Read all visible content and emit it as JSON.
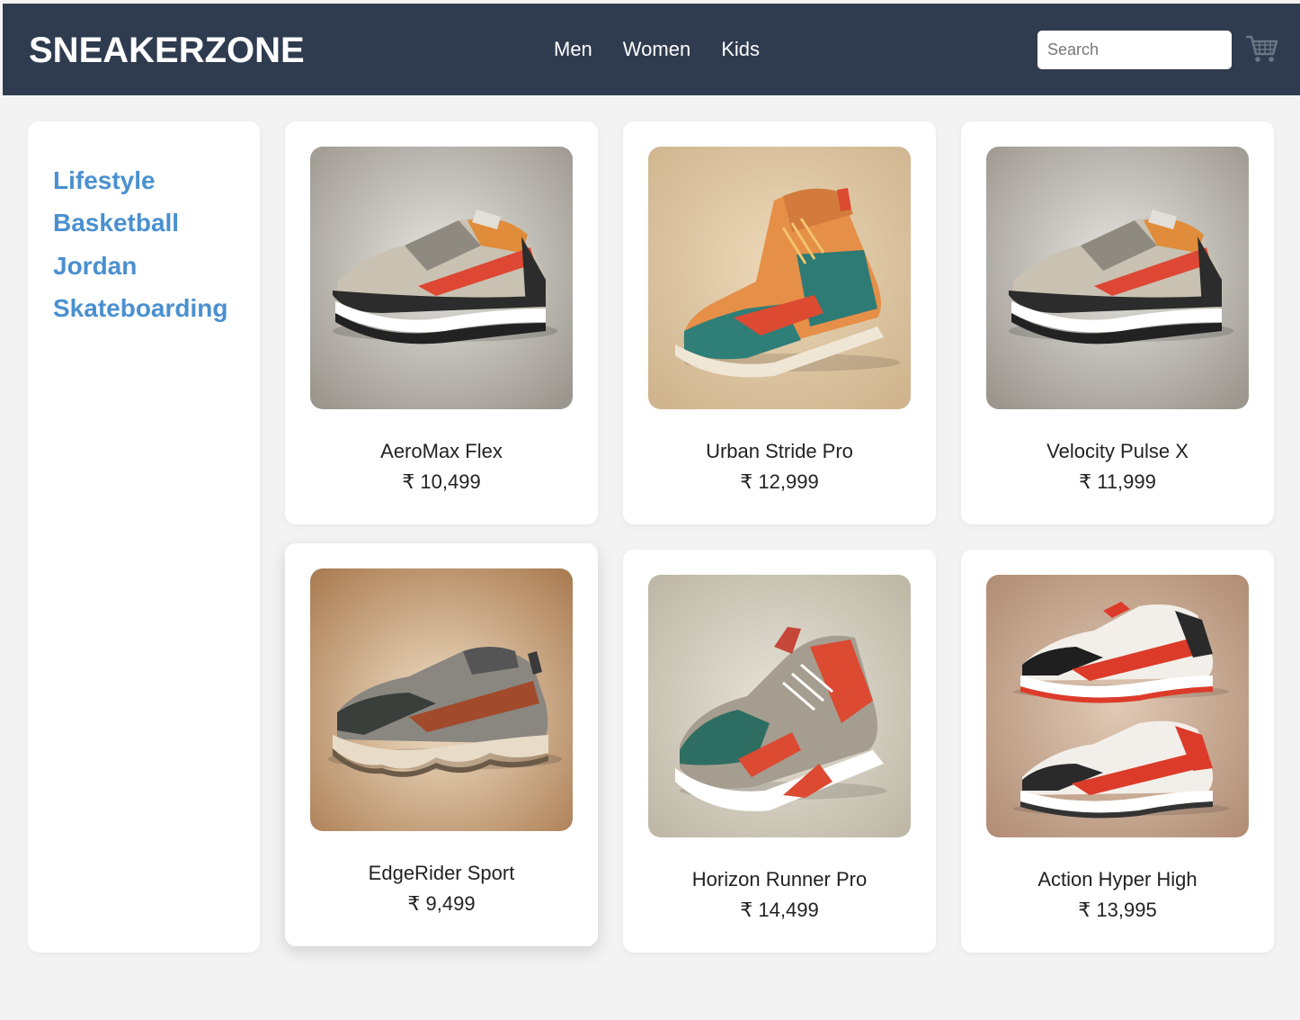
{
  "header": {
    "logo": "SNEAKERZONE",
    "nav": [
      "Men",
      "Women",
      "Kids"
    ],
    "search_placeholder": "Search",
    "cart_icon": "shopping-cart-icon",
    "bg_color": "#2f3c4f"
  },
  "sidebar": {
    "categories": [
      "Lifestyle",
      "Basketball",
      "Jordan",
      "Skateboarding"
    ],
    "link_color": "#4a90d0"
  },
  "products": [
    {
      "name": "AeroMax Flex",
      "price": "₹ 10,499"
    },
    {
      "name": "Urban Stride Pro",
      "price": "₹ 12,999"
    },
    {
      "name": "Velocity Pulse X",
      "price": "₹ 11,999"
    },
    {
      "name": "EdgeRider Sport",
      "price": "₹ 9,499"
    },
    {
      "name": "Horizon Runner Pro",
      "price": "₹ 14,499"
    },
    {
      "name": "Action Hyper High",
      "price": "₹ 13,995"
    }
  ]
}
